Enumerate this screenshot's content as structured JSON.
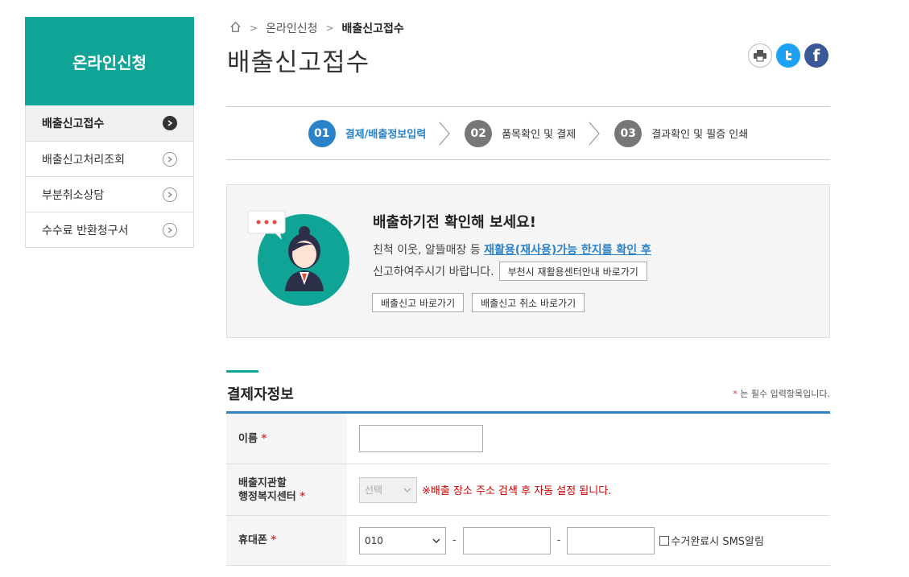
{
  "sidebar": {
    "title": "온라인신청",
    "items": [
      {
        "label": "배출신고접수"
      },
      {
        "label": "배출신고처리조회"
      },
      {
        "label": "부분취소상담"
      },
      {
        "label": "수수료 반환청구서"
      }
    ]
  },
  "breadcrumb": {
    "level1": "온라인신청",
    "level2": "배출신고접수"
  },
  "page_title": "배출신고접수",
  "share": {
    "facebook_glyph": "f"
  },
  "steps": [
    {
      "num": "01",
      "label": "결제/배출정보입력"
    },
    {
      "num": "02",
      "label": "품목확인 및 결제"
    },
    {
      "num": "03",
      "label": "결과확인 및 필증 인쇄"
    }
  ],
  "notice": {
    "title": "배출하기전 확인해 보세요!",
    "line1_prefix": "친척 이웃, 알뜰매장 등 ",
    "line1_link": "재활용(재사용)가능 한지를 확인 후",
    "line2": "신고하여주시기 바랍니다.",
    "center_button": "부천시 재활용센터안내 바로가기",
    "btn_report": "배출신고 바로가기",
    "btn_cancel": "배출신고 취소 바로가기"
  },
  "section": {
    "title": "결제자정보",
    "required_mark": "*",
    "required_note": " 는 필수 입력항목입니다."
  },
  "form": {
    "name_label": "이름",
    "center_label_line1": "배출지관할",
    "center_label_line2": "행정복지센터",
    "center_select": "선택",
    "center_hint": "※배출 장소 주소 검색 후 자동 설정 됩니다.",
    "phone_label": "휴대폰",
    "phone_prefix": "010",
    "dash": "-",
    "sms_label": "수거완료시 SMS알림",
    "required_mark": "*"
  },
  "colors": {
    "brand_teal": "#0fa495",
    "accent_blue": "#2a82c9",
    "required_red": "#d33"
  }
}
